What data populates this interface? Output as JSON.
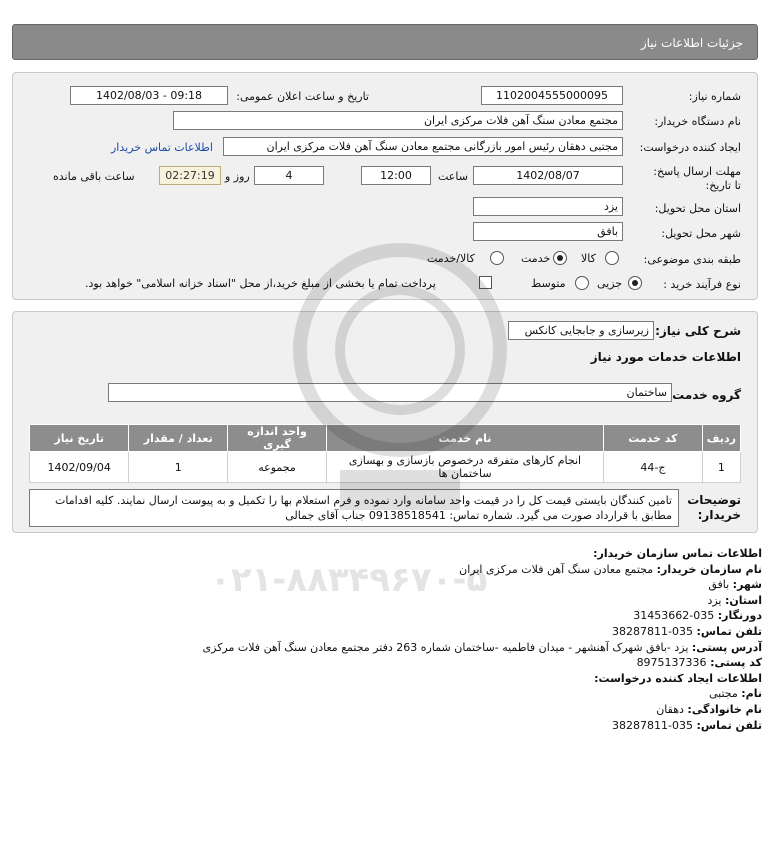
{
  "header": {
    "title": "جزئیات اطلاعات نیاز"
  },
  "details": {
    "need_number_label": "شماره نیاز:",
    "need_number": "1102004555000095",
    "announce_label": "تاریخ و ساعت اعلان عمومی:",
    "announce_value": "1402/08/03 - 09:18",
    "buyer_label": "نام دستگاه خریدار:",
    "buyer_value": "مجتمع معادن سنگ آهن فلات مرکزی ایران",
    "creator_label": "ایجاد کننده درخواست:",
    "creator_value": "مجتبی  دهقان رئیس امور بازرگانی مجتمع معادن سنگ آهن فلات مرکزی ایران",
    "contact_link": "اطلاعات تماس خریدار",
    "deadline_label": "مهلت ارسال پاسخ: تا تاریخ:",
    "deadline_date": "1402/08/07",
    "time_label": "ساعت",
    "deadline_time": "12:00",
    "days_value": "4",
    "days_label": "روز و",
    "remaining_time": "02:27:19",
    "remaining_label": "ساعت باقی مانده",
    "province_label": "استان محل تحویل:",
    "province_value": "یزد",
    "city_label": "شهر محل تحویل:",
    "city_value": "بافق",
    "category_label": "طبقه بندی موضوعی:",
    "category_options": [
      "کالا",
      "خدمت",
      "کالا/خدمت"
    ],
    "category_selected": "خدمت",
    "process_label": "نوع فرآیند خرید :",
    "process_options": [
      "جزیی",
      "متوسط"
    ],
    "process_selected": "جزیی",
    "payment_note": "پرداخت تمام یا بخشی از مبلغ خرید،از محل \"اسناد خزانه اسلامی\" خواهد بود."
  },
  "services": {
    "summary_label": "شرح کلی نیاز:",
    "summary_value": "زیرسازی و جابجایی کانکس",
    "section_title": "اطلاعات خدمات مورد نیاز",
    "group_label": "گروه خدمت:",
    "group_value": "ساختمان",
    "columns": [
      "ردیف",
      "کد خدمت",
      "نام خدمت",
      "واحد اندازه گیری",
      "تعداد / مقدار",
      "تاریخ نیاز"
    ],
    "rows": [
      [
        "1",
        "ج-44",
        "انجام کارهای متفرقه درخصوص بازسازی و بهسازی ساختمان ها",
        "مجموعه",
        "1",
        "1402/09/04"
      ]
    ],
    "notes_label": "توضیحات خریدار:",
    "notes_value": "تامین کنندگان بایستی قیمت کل را در قیمت واحد سامانه وارد نموده و فرم استعلام بها را تکمیل و به پیوست ارسال نمایند. کلیه اقدامات مطابق با قرارداد صورت می گیرد. شماره تماس: 09138518541 جناب آقای جمالی"
  },
  "contact": {
    "org_title": "اطلاعات تماس سازمان خریدار:",
    "org_name_label": "نام سازمان خریدار:",
    "org_name": "مجتمع معادن سنگ آهن فلات مرکزی ایران",
    "city_label": "شهر:",
    "city": "بافق",
    "province_label": "استان:",
    "province": "یزد",
    "fax_label": "دورنگار:",
    "fax": "035-31453662",
    "phone_label": "تلفن تماس:",
    "phone": "035-38287811",
    "address_label": "آدرس پستی:",
    "address": "یزد -بافق شهرک آهنشهر - میدان فاطمیه -ساختمان شماره 263 دفتر مجتمع معادن سنگ آهن فلات مرکزی",
    "postal_label": "کد پستی:",
    "postal": "8975137336",
    "creator_title": "اطلاعات ایجاد کننده درخواست:",
    "first_name_label": "نام:",
    "first_name": "مجتبی",
    "last_name_label": "نام خانوادگی:",
    "last_name": "دهقان",
    "creator_phone_label": "تلفن تماس:",
    "creator_phone": "035-38287811"
  },
  "watermark": {
    "phone": "۰۲۱-۸۸۳۴۹۶۷۰-۵"
  },
  "colors": {
    "header_bg": "#8a8a8a",
    "panel_bg": "#f0f0f0",
    "link": "#1a4aa8",
    "table_header": "#8d8d8d"
  }
}
